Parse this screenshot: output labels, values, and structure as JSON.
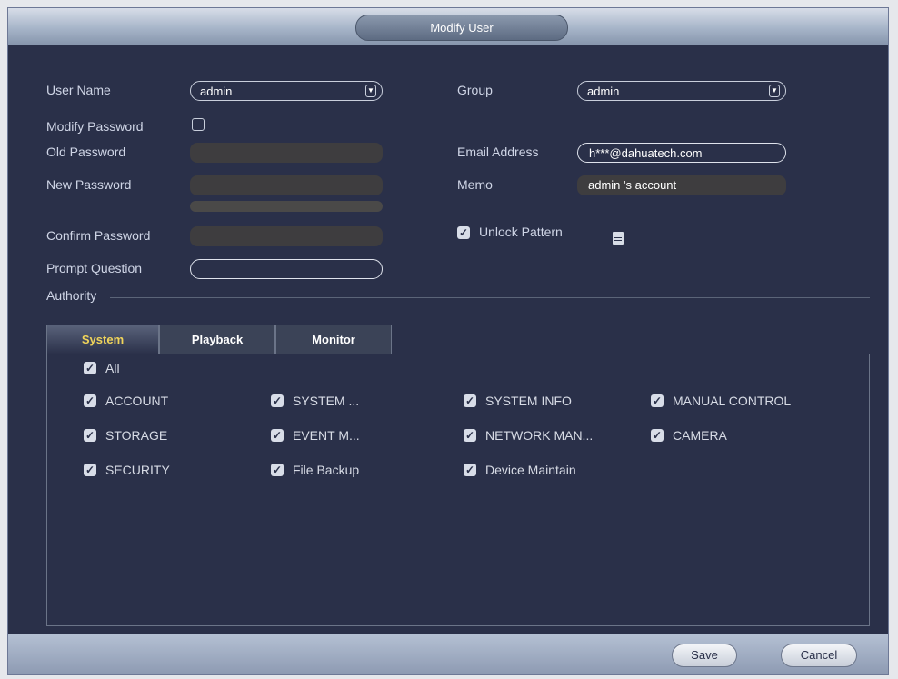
{
  "window": {
    "title": "Modify User"
  },
  "form": {
    "user_name": {
      "label": "User Name",
      "value": "admin"
    },
    "modify_password": {
      "label": "Modify Password",
      "checked": false
    },
    "old_password": {
      "label": "Old Password",
      "value": ""
    },
    "new_password": {
      "label": "New Password",
      "value": ""
    },
    "confirm_password": {
      "label": "Confirm Password",
      "value": ""
    },
    "prompt_question": {
      "label": "Prompt Question",
      "value": ""
    },
    "group": {
      "label": "Group",
      "value": "admin"
    },
    "email": {
      "label": "Email Address",
      "value": "h***@dahuatech.com"
    },
    "memo": {
      "label": "Memo",
      "value": "admin 's account"
    },
    "unlock_pattern": {
      "label": "Unlock Pattern",
      "checked": true
    }
  },
  "authority": {
    "label": "Authority",
    "tabs": [
      {
        "label": "System",
        "active": true
      },
      {
        "label": "Playback",
        "active": false
      },
      {
        "label": "Monitor",
        "active": false
      }
    ],
    "all_label": "All",
    "permissions": [
      "ACCOUNT",
      "SYSTEM ...",
      "SYSTEM INFO",
      "MANUAL CONTROL",
      "STORAGE",
      "EVENT M...",
      "NETWORK MAN...",
      "CAMERA",
      "SECURITY",
      "File Backup",
      "Device Maintain"
    ]
  },
  "buttons": {
    "save": "Save",
    "cancel": "Cancel"
  },
  "colors": {
    "background": "#2a3049",
    "active_tab_text": "#f0d45a"
  }
}
